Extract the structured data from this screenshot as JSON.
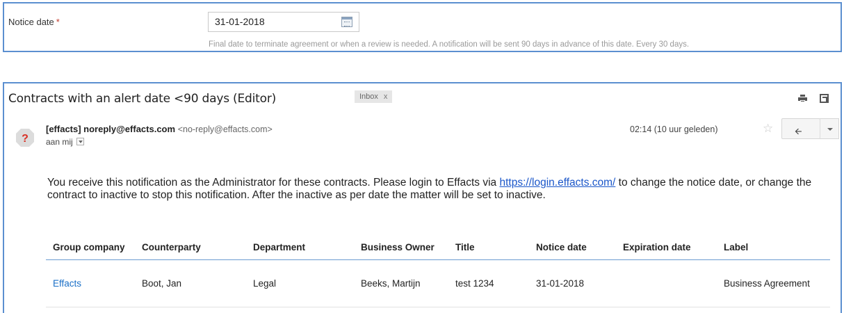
{
  "notice": {
    "label": "Notice date",
    "required_mark": "*",
    "value": "31-01-2018",
    "help": "Final date to terminate agreement or when a review is needed. A notification will be sent 90 days in advance of this date. Every 30 days."
  },
  "mail": {
    "subject": "Contracts with an alert date <90 days (Editor)",
    "inbox_tag": "Inbox",
    "inbox_close": "x",
    "sender_name": "[effacts] noreply@effacts.com",
    "sender_addr": "<no-reply@effacts.com>",
    "recipient": "aan mij",
    "time": "02:14 (10 uur geleden)",
    "star": "☆",
    "reply_glyph": "🡨",
    "message_before": "You receive this notification as the Administrator for these contracts. Please login to Effacts via ",
    "message_link": "https://login.effacts.com/",
    "message_after": " to change the notice date, or change the contract to inactive to stop this notification. After the inactive as per date the matter will be set to inactive."
  },
  "table": {
    "headers": [
      "Group company",
      "Counterparty",
      "Department",
      "Business Owner",
      "Title",
      "Notice date",
      "Expiration date",
      "Label"
    ],
    "rows": [
      [
        "Effacts",
        "Boot, Jan",
        "Legal",
        "Beeks, Martijn",
        "test 1234",
        "31-01-2018",
        "",
        "Business Agreement"
      ]
    ]
  },
  "colors": {
    "panel_border": "#5b8fd0",
    "link": "#1a56c9",
    "required": "#c0392b",
    "avatar_red": "#d93025"
  }
}
